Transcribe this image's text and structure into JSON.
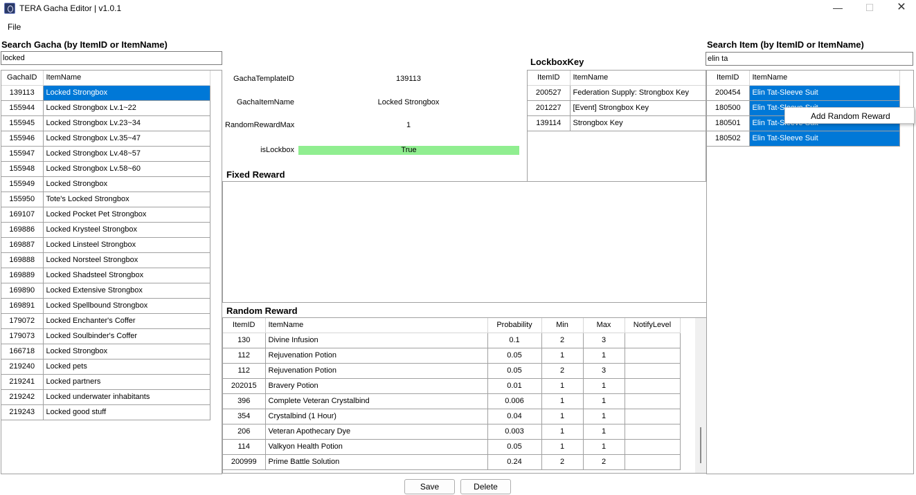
{
  "window": {
    "title": "TERA Gacha Editor | v1.0.1",
    "minimize": "—",
    "maximize": "☐",
    "close": "✕"
  },
  "menu": {
    "file": "File"
  },
  "gacha_search": {
    "label": "Search Gacha (by ItemID or ItemName)",
    "value": "locked",
    "columns": [
      "GachaID",
      "ItemName"
    ],
    "rows": [
      [
        "139113",
        "Locked Strongbox"
      ],
      [
        "155944",
        "Locked Strongbox Lv.1~22"
      ],
      [
        "155945",
        "Locked Strongbox Lv.23~34"
      ],
      [
        "155946",
        "Locked Strongbox Lv.35~47"
      ],
      [
        "155947",
        "Locked Strongbox Lv.48~57"
      ],
      [
        "155948",
        "Locked Strongbox Lv.58~60"
      ],
      [
        "155949",
        "Locked Strongbox"
      ],
      [
        "155950",
        "Tote's Locked Strongbox"
      ],
      [
        "169107",
        "Locked Pocket Pet Strongbox"
      ],
      [
        "169886",
        "Locked Krysteel Strongbox"
      ],
      [
        "169887",
        "Locked Linsteel Strongbox"
      ],
      [
        "169888",
        "Locked Norsteel Strongbox"
      ],
      [
        "169889",
        "Locked Shadsteel Strongbox"
      ],
      [
        "169890",
        "Locked Extensive Strongbox"
      ],
      [
        "169891",
        "Locked Spellbound Strongbox"
      ],
      [
        "179072",
        "Locked Enchanter's Coffer"
      ],
      [
        "179073",
        "Locked Soulbinder's Coffer"
      ],
      [
        "166718",
        "Locked Strongbox"
      ],
      [
        "219240",
        "Locked pets"
      ],
      [
        "219241",
        "Locked partners"
      ],
      [
        "219242",
        "Locked underwater inhabitants"
      ],
      [
        "219243",
        "Locked good stuff"
      ]
    ]
  },
  "details": {
    "template_id_label": "GachaTemplateID",
    "template_id": "139113",
    "item_name_label": "GachaItemName",
    "item_name": "Locked Strongbox",
    "random_max_label": "RandomRewardMax",
    "random_max": "1",
    "is_lockbox_label": "isLockbox",
    "is_lockbox": "True"
  },
  "lockbox_key": {
    "label": "LockboxKey",
    "columns": [
      "ItemID",
      "ItemName"
    ],
    "rows": [
      [
        "200527",
        "Federation Supply: Strongbox Key"
      ],
      [
        "201227",
        "[Event] Strongbox Key"
      ],
      [
        "139114",
        "Strongbox Key"
      ]
    ]
  },
  "fixed_reward": {
    "label": "Fixed Reward"
  },
  "random_reward": {
    "label": "Random Reward",
    "columns": [
      "ItemID",
      "ItemName",
      "Probability",
      "Min",
      "Max",
      "NotifyLevel"
    ],
    "rows": [
      [
        "130",
        "Divine Infusion",
        "0.1",
        "2",
        "3",
        ""
      ],
      [
        "112",
        "Rejuvenation Potion",
        "0.05",
        "1",
        "1",
        ""
      ],
      [
        "112",
        "Rejuvenation Potion",
        "0.05",
        "2",
        "3",
        ""
      ],
      [
        "202015",
        "Bravery Potion",
        "0.01",
        "1",
        "1",
        ""
      ],
      [
        "396",
        "Complete Veteran Crystalbind",
        "0.006",
        "1",
        "1",
        ""
      ],
      [
        "354",
        "Crystalbind (1 Hour)",
        "0.04",
        "1",
        "1",
        ""
      ],
      [
        "206",
        "Veteran Apothecary Dye",
        "0.003",
        "1",
        "1",
        ""
      ],
      [
        "114",
        "Valkyon Health Potion",
        "0.05",
        "1",
        "1",
        ""
      ],
      [
        "200999",
        "Prime Battle Solution",
        "0.24",
        "2",
        "2",
        ""
      ]
    ]
  },
  "item_search": {
    "label": "Search Item (by ItemID or ItemName)",
    "value": "elin ta",
    "columns": [
      "ItemID",
      "ItemName"
    ],
    "rows": [
      [
        "200454",
        "Elin Tat-Sleeve Suit"
      ],
      [
        "180500",
        "Elin Tat-Sleeve Suit"
      ],
      [
        "180501",
        "Elin Tat-Sleeve Suit"
      ],
      [
        "180502",
        "Elin Tat-Sleeve Suit"
      ]
    ]
  },
  "context_menu": {
    "item": "Add Random Reward"
  },
  "buttons": {
    "save": "Save",
    "delete": "Delete"
  },
  "colors": {
    "selection": "#0078d7",
    "lockbox_true": "#90ee90"
  }
}
